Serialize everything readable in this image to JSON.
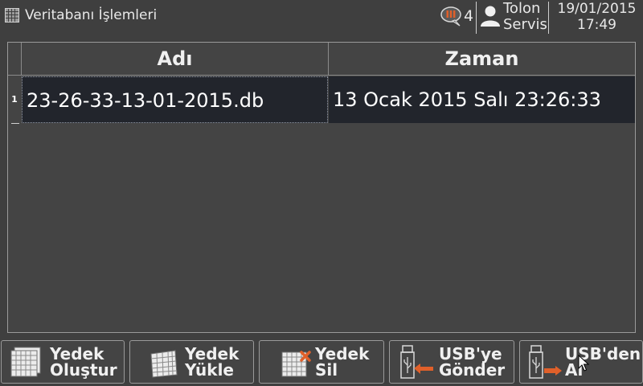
{
  "header": {
    "title": "Veritabanı İşlemleri",
    "app_icon": "grid-table-icon",
    "alarm_icon": "alarm-speech-bubble-icon",
    "alarm_count": "4",
    "user_icon": "user-icon",
    "user_name_line1": "Tolon",
    "user_name_line2": "Servis",
    "date": "19/01/2015",
    "time": "17:49"
  },
  "table": {
    "columns": [
      "Adı",
      "Zaman"
    ],
    "rows": [
      {
        "index": "1",
        "name": "23-26-33-13-01-2015.db",
        "time": "13 Ocak 2015 Salı 23:26:33"
      }
    ]
  },
  "buttons": [
    {
      "line1": "Yedek",
      "line2": "Oluştur",
      "icon": "backup-create-icon"
    },
    {
      "line1": "Yedek",
      "line2": "Yükle",
      "icon": "backup-load-icon"
    },
    {
      "line1": "Yedek",
      "line2": "Sil",
      "icon": "backup-delete-icon"
    },
    {
      "line1": "USB'ye",
      "line2": "Gönder",
      "icon": "usb-send-icon"
    },
    {
      "line1": "USB'den",
      "line2": "Al",
      "icon": "usb-receive-icon"
    }
  ],
  "colors": {
    "background": "#3f3f3f",
    "selected_row": "#22252c",
    "accent_red": "#e0602a"
  }
}
